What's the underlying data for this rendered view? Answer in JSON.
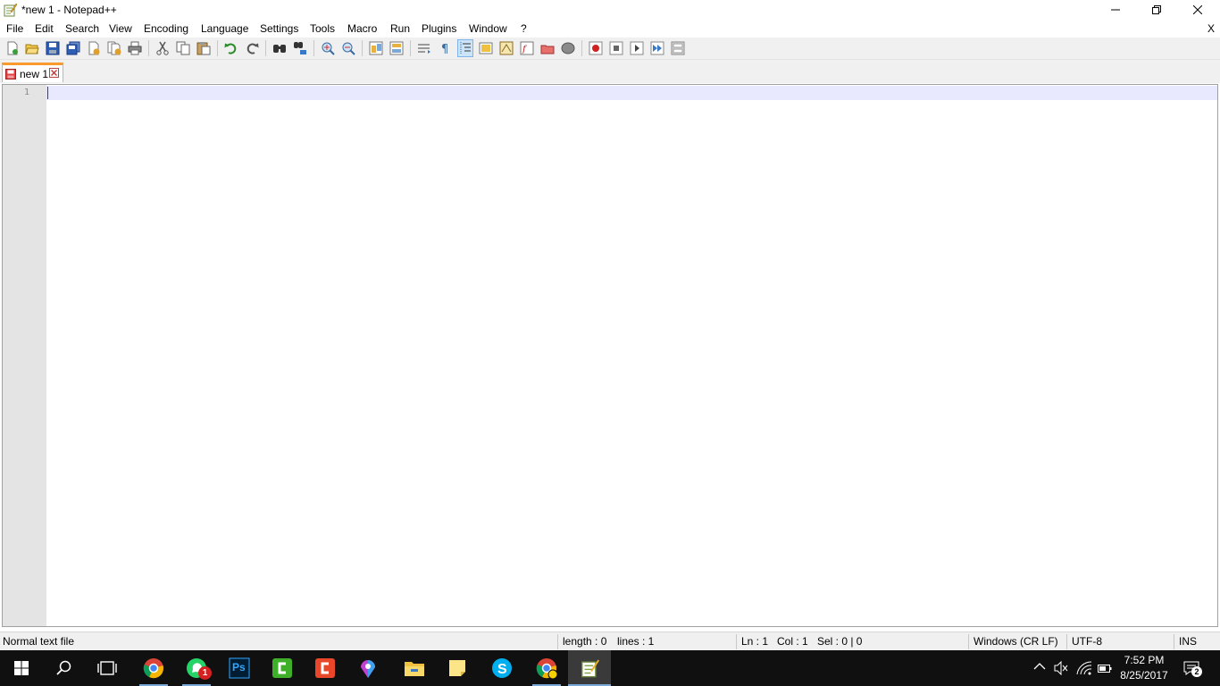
{
  "window": {
    "title": "*new 1 - Notepad++",
    "minimize_icon": "minimize-icon",
    "maximize_icon": "restore-icon",
    "close_icon": "close-icon"
  },
  "menu": {
    "items": [
      "File",
      "Edit",
      "Search",
      "View",
      "Encoding",
      "Language",
      "Settings",
      "Tools",
      "Macro",
      "Run",
      "Plugins",
      "Window",
      "?"
    ],
    "close_doc_label": "X"
  },
  "toolbar": {
    "buttons": [
      "new-file-icon",
      "open-file-icon",
      "save-icon",
      "save-all-icon",
      "close-icon",
      "close-all-icon",
      "print-icon",
      "cut-icon",
      "copy-icon",
      "paste-icon",
      "undo-icon",
      "redo-icon",
      "find-icon",
      "replace-icon",
      "zoom-in-icon",
      "zoom-out-icon",
      "sync-vertical-icon",
      "sync-horizontal-icon",
      "word-wrap-icon",
      "show-all-chars-icon",
      "indent-guide-icon",
      "user-language-icon",
      "doc-map-icon",
      "function-list-icon",
      "folder-workspace-icon",
      "monitoring-icon",
      "record-macro-icon",
      "stop-macro-icon",
      "play-macro-icon",
      "run-macro-multiple-icon",
      "save-macro-icon"
    ]
  },
  "tabs": [
    {
      "label": "new 1",
      "icon": "unsaved-file-icon",
      "close_icon": "tab-close-icon"
    }
  ],
  "editor": {
    "line_numbers": [
      "1"
    ],
    "content": ""
  },
  "status": {
    "file_type": "Normal text file",
    "length": "length : 0",
    "lines": "lines : 1",
    "ln": "Ln : 1",
    "col": "Col : 1",
    "sel": "Sel : 0 | 0",
    "eol": "Windows (CR LF)",
    "encoding": "UTF-8",
    "mode": "INS"
  },
  "taskbar": {
    "apps": [
      {
        "name": "chrome-icon"
      },
      {
        "name": "whatsapp-icon",
        "badge": "1"
      },
      {
        "name": "photoshop-icon",
        "label": "Ps"
      },
      {
        "name": "camtasia-icon"
      },
      {
        "name": "camtasia-recorder-icon"
      },
      {
        "name": "maps-icon"
      },
      {
        "name": "file-explorer-icon"
      },
      {
        "name": "sticky-notes-icon"
      },
      {
        "name": "skype-icon"
      },
      {
        "name": "chrome-profile-icon"
      },
      {
        "name": "notepadpp-icon"
      }
    ],
    "clock_time": "7:52 PM",
    "clock_date": "8/25/2017",
    "notification_count": "2"
  }
}
